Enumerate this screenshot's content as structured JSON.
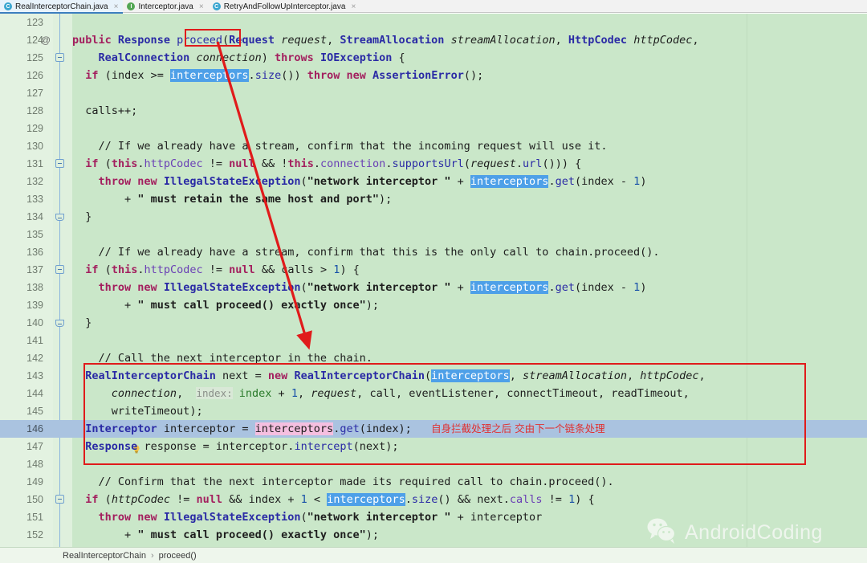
{
  "tabs": [
    {
      "label": "RealInterceptorChain.java",
      "icon": "java-class-icon",
      "icon_letter": "C",
      "active": true,
      "close": "×"
    },
    {
      "label": "Interceptor.java",
      "icon": "java-interface-icon",
      "icon_letter": "I",
      "active": false,
      "close": "×"
    },
    {
      "label": "RetryAndFollowUpInterceptor.java",
      "icon": "java-class-icon",
      "icon_letter": "C",
      "active": false,
      "close": "×"
    }
  ],
  "editor": {
    "background": "#cae7c9",
    "gutter_background": "#e3f2e1",
    "current_line_background": "#aac3e0",
    "selection_highlight": "#4ea0e8",
    "occurrence_highlight": "#f5bfe0",
    "annotation_color": "#e01b1b",
    "current_line_number": "146",
    "annotation_marker": "@",
    "lightbulb_icon": "intention-bulb-icon"
  },
  "code": {
    "lines": [
      {
        "n": "123",
        "text": ""
      },
      {
        "n": "124",
        "text": "  public Response proceed(Request request, StreamAllocation streamAllocation, HttpCodec httpCodec,"
      },
      {
        "n": "125",
        "text": "      RealConnection connection) throws IOException {"
      },
      {
        "n": "126",
        "text": "    if (index >= interceptors.size()) throw new AssertionError();"
      },
      {
        "n": "127",
        "text": ""
      },
      {
        "n": "128",
        "text": "    calls++;"
      },
      {
        "n": "129",
        "text": ""
      },
      {
        "n": "130",
        "text": "    // If we already have a stream, confirm that the incoming request will use it."
      },
      {
        "n": "131",
        "text": "    if (this.httpCodec != null && !this.connection.supportsUrl(request.url())) {"
      },
      {
        "n": "132",
        "text": "      throw new IllegalStateException(\"network interceptor \" + interceptors.get(index - 1)"
      },
      {
        "n": "133",
        "text": "          + \" must retain the same host and port\");"
      },
      {
        "n": "134",
        "text": "    }"
      },
      {
        "n": "135",
        "text": ""
      },
      {
        "n": "136",
        "text": "    // If we already have a stream, confirm that this is the only call to chain.proceed()."
      },
      {
        "n": "137",
        "text": "    if (this.httpCodec != null && calls > 1) {"
      },
      {
        "n": "138",
        "text": "      throw new IllegalStateException(\"network interceptor \" + interceptors.get(index - 1)"
      },
      {
        "n": "139",
        "text": "          + \" must call proceed() exactly once\");"
      },
      {
        "n": "140",
        "text": "    }"
      },
      {
        "n": "141",
        "text": ""
      },
      {
        "n": "142",
        "text": "    // Call the next interceptor in the chain."
      },
      {
        "n": "143",
        "text": "    RealInterceptorChain next = new RealInterceptorChain(interceptors, streamAllocation, httpCodec,"
      },
      {
        "n": "144",
        "text": "        connection,  index: index + 1, request, call, eventListener, connectTimeout, readTimeout,"
      },
      {
        "n": "145",
        "text": "        writeTimeout);"
      },
      {
        "n": "146",
        "text": "    Interceptor interceptor = interceptors.get(index);   自身拦截处理之后 交由下一个链条处理"
      },
      {
        "n": "147",
        "text": "    Response response = interceptor.intercept(next);"
      },
      {
        "n": "148",
        "text": ""
      },
      {
        "n": "149",
        "text": "    // Confirm that the next interceptor made its required call to chain.proceed()."
      },
      {
        "n": "150",
        "text": "    if (httpCodec != null && index + 1 < interceptors.size() && next.calls != 1) {"
      },
      {
        "n": "151",
        "text": "      throw new IllegalStateException(\"network interceptor \" + interceptor"
      },
      {
        "n": "152",
        "text": "          + \" must call proceed() exactly once\");"
      }
    ],
    "inline_hint": "index:",
    "chinese_comment": "自身拦截处理之后 交由下一个链条处理",
    "highlighted_word": "interceptors",
    "boxed_word": "proceed"
  },
  "breadcrumb": {
    "class": "RealInterceptorChain",
    "separator": "›",
    "method": "proceed()"
  },
  "watermark": {
    "text": "AndroidCoding",
    "icon": "wechat-logo-icon"
  }
}
